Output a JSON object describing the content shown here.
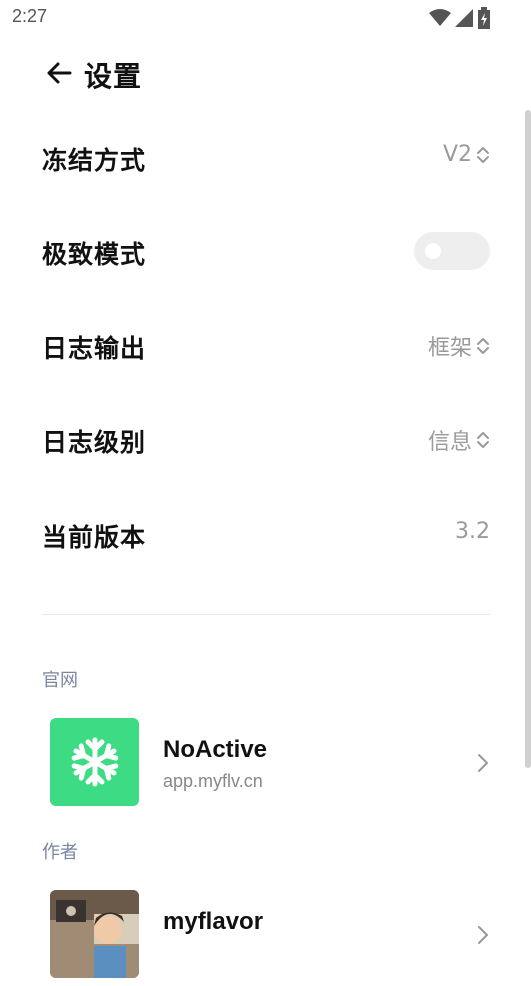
{
  "status_bar": {
    "time": "2:27"
  },
  "header": {
    "title": "设置"
  },
  "settings": [
    {
      "label": "冻结方式",
      "value": "V2",
      "type": "select"
    },
    {
      "label": "极致模式",
      "type": "toggle",
      "enabled": false
    },
    {
      "label": "日志输出",
      "value": "框架",
      "type": "select"
    },
    {
      "label": "日志级别",
      "value": "信息",
      "type": "select"
    },
    {
      "label": "当前版本",
      "value": "3.2",
      "type": "text"
    }
  ],
  "website": {
    "section_label": "官网",
    "title": "NoActive",
    "subtitle": "app.myflv.cn",
    "icon": "snowflake-icon",
    "icon_color": "#3ddc84"
  },
  "author": {
    "section_label": "作者",
    "title": "myflavor",
    "icon": "avatar-image"
  }
}
